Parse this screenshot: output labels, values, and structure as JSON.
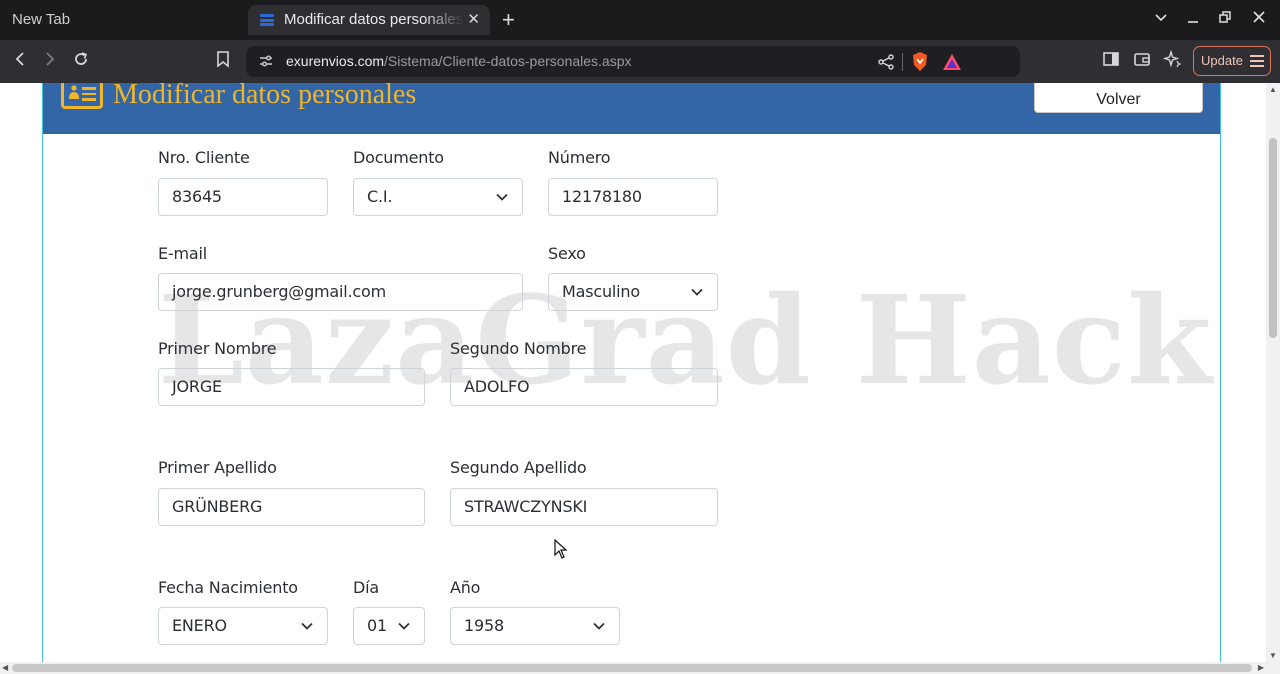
{
  "browser": {
    "tabs": [
      {
        "label": "New Tab"
      },
      {
        "label": "Modificar datos personales"
      }
    ],
    "new_tab_symbol": "+",
    "close_symbol": "✕",
    "url_host": "exurenvios.com",
    "url_path": "/Sistema/Cliente-datos-personales.aspx",
    "update_label": "Update"
  },
  "header": {
    "title": "Modificar datos personales",
    "back_button": "Volver"
  },
  "watermark": "LazaGrad Hack",
  "form": {
    "nro_cliente": {
      "label": "Nro. Cliente",
      "value": "83645"
    },
    "documento": {
      "label": "Documento",
      "value": "C.I."
    },
    "numero": {
      "label": "Número",
      "value": "12178180"
    },
    "email": {
      "label": "E-mail",
      "value": "jorge.grunberg@gmail.com"
    },
    "sexo": {
      "label": "Sexo",
      "value": "Masculino"
    },
    "primer_nombre": {
      "label": "Primer Nombre",
      "value": "JORGE"
    },
    "segundo_nombre": {
      "label": "Segundo Nombre",
      "value": "ADOLFO"
    },
    "primer_apellido": {
      "label": "Primer Apellido",
      "value": "GRÜNBERG"
    },
    "segundo_apellido": {
      "label": "Segundo Apellido",
      "value": "STRAWCZYNSKI"
    },
    "fecha_nacimiento": {
      "label": "Fecha Nacimiento",
      "value": "ENERO"
    },
    "dia": {
      "label": "Día",
      "value": "01"
    },
    "anio": {
      "label": "Año",
      "value": "1958"
    }
  },
  "colors": {
    "header_bg": "#3366a6",
    "header_title": "#f0b52b",
    "panel_border": "#3fc6d4",
    "update_border": "#e0745a"
  }
}
